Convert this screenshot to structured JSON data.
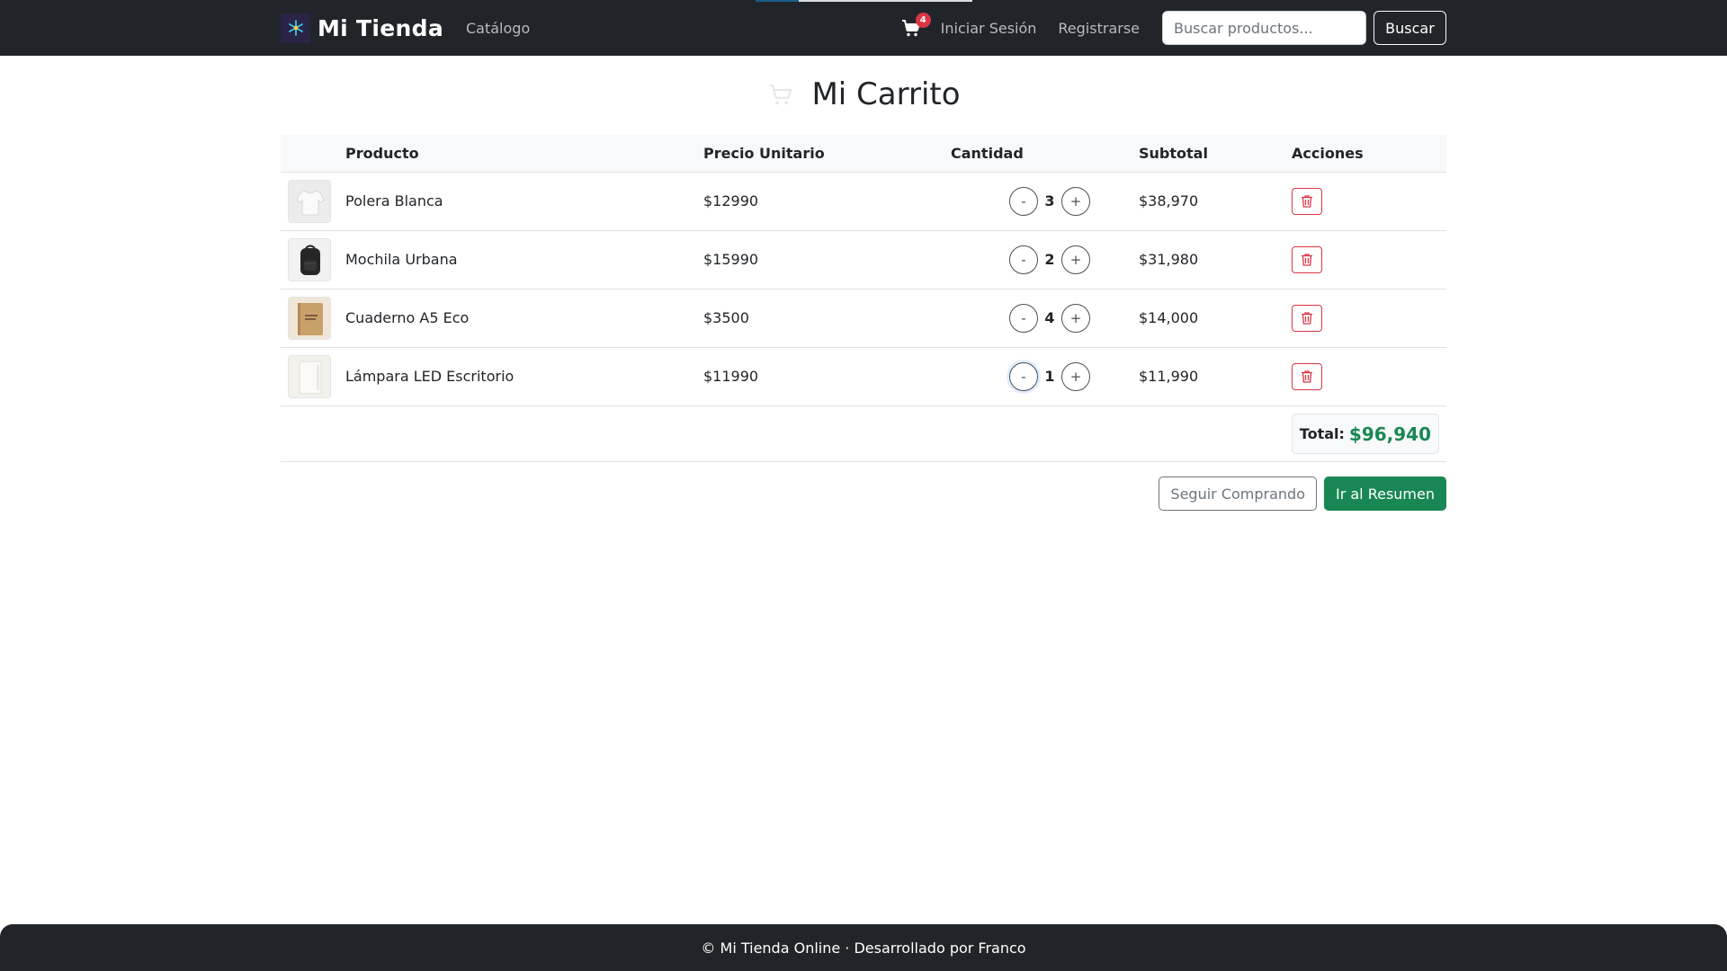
{
  "navbar": {
    "brand": "Mi Tienda",
    "catalog_label": "Catálogo",
    "cart_count": "4",
    "login_label": "Iniciar Sesión",
    "register_label": "Registrarse",
    "search_placeholder": "Buscar productos...",
    "search_button": "Buscar",
    "icons": {
      "logo": "logo-icon",
      "cart": "cart-icon"
    }
  },
  "page": {
    "title": "Mi Carrito",
    "title_icon": "cart-icon"
  },
  "table": {
    "headers": [
      "",
      "Producto",
      "Precio Unitario",
      "Cantidad",
      "Subtotal",
      "Acciones"
    ],
    "rows": [
      {
        "name": "Polera Blanca",
        "price": "$12990",
        "qty": "3",
        "subtotal": "$38,970",
        "thumb": "tshirt-thumb"
      },
      {
        "name": "Mochila Urbana",
        "price": "$15990",
        "qty": "2",
        "subtotal": "$31,980",
        "thumb": "backpack-thumb"
      },
      {
        "name": "Cuaderno A5 Eco",
        "price": "$3500",
        "qty": "4",
        "subtotal": "$14,000",
        "thumb": "notebook-thumb"
      },
      {
        "name": "Lámpara LED Escritorio",
        "price": "$11990",
        "qty": "1",
        "subtotal": "$11,990",
        "thumb": "lamp-thumb"
      }
    ],
    "decrement_label": "-",
    "increment_label": "+",
    "delete_icon": "trash-icon"
  },
  "summary": {
    "total_label": "Total:",
    "total_value": "$96,940"
  },
  "actions": {
    "continue_label": "Seguir Comprando",
    "checkout_label": "Ir al Resumen"
  },
  "footer": {
    "text": "© Mi Tienda Online · Desarrollado por Franco"
  },
  "colors": {
    "navbar_bg": "#212529",
    "success": "#198754",
    "danger": "#dc3545",
    "muted": "#6c757d"
  }
}
